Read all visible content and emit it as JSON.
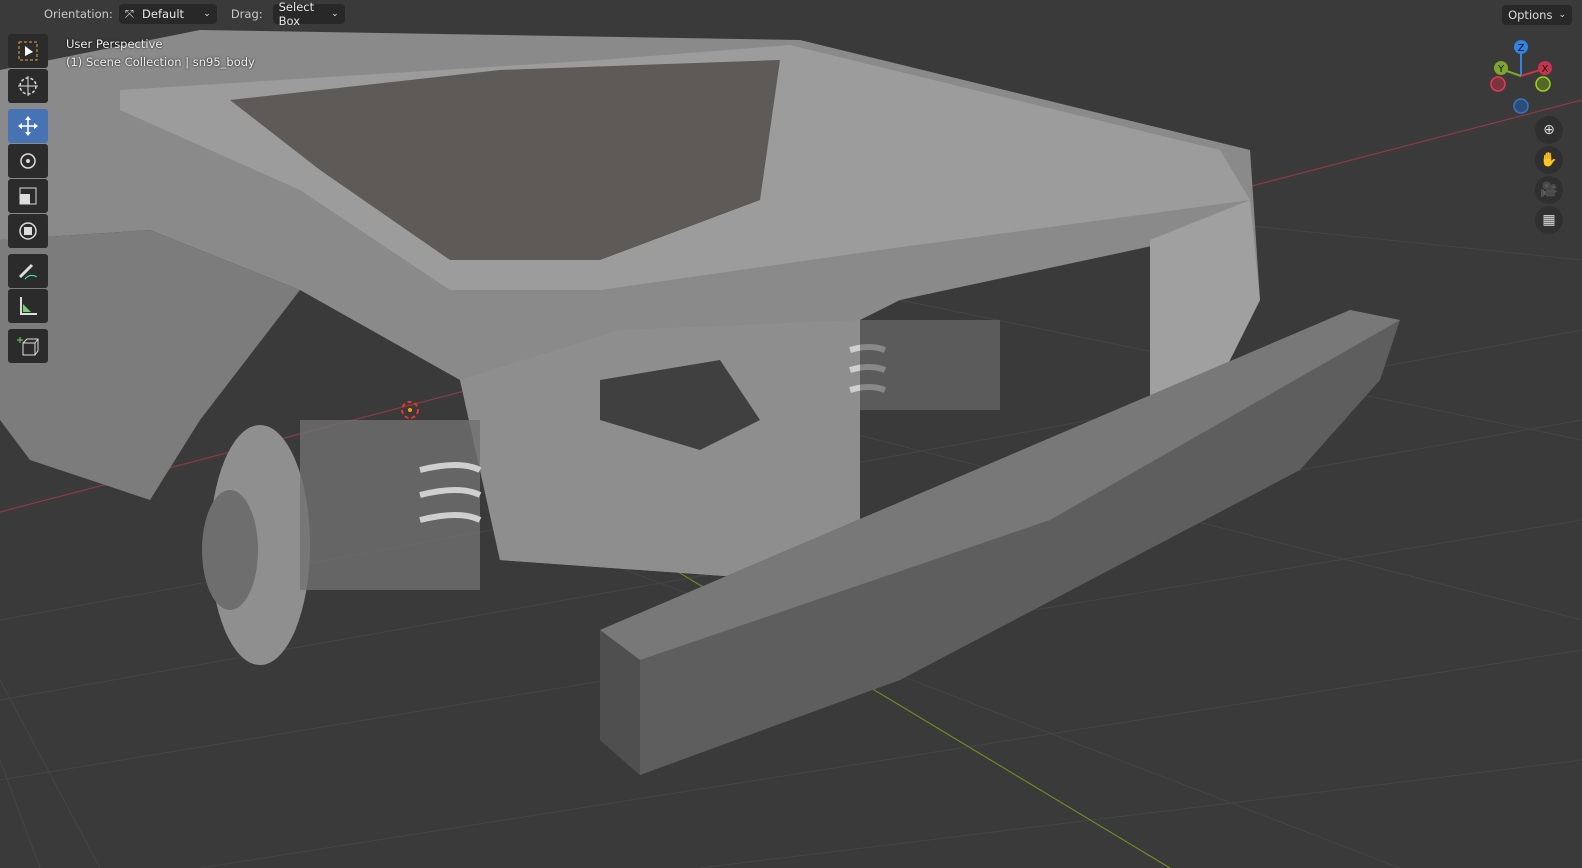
{
  "header": {
    "orientation_label": "Orientation:",
    "orientation_value": "Default",
    "drag_label": "Drag:",
    "drag_value": "Select Box",
    "options_label": "Options"
  },
  "viewport": {
    "view_name": "User Perspective",
    "object_info": "(1) Scene Collection | sn95_body"
  },
  "toolbar": {
    "tools": [
      "select-box",
      "cursor",
      "move",
      "rotate",
      "scale",
      "transform",
      "annotate",
      "measure",
      "add-cube"
    ],
    "active": "move"
  },
  "gizmo": {
    "axes": [
      "Z",
      "Y",
      "X"
    ],
    "colors": {
      "x": "#c8344c",
      "y": "#7fa62a",
      "z": "#2f84e6"
    }
  },
  "colors": {
    "background": "#3a3a3a",
    "active_tool": "#4772b3"
  }
}
